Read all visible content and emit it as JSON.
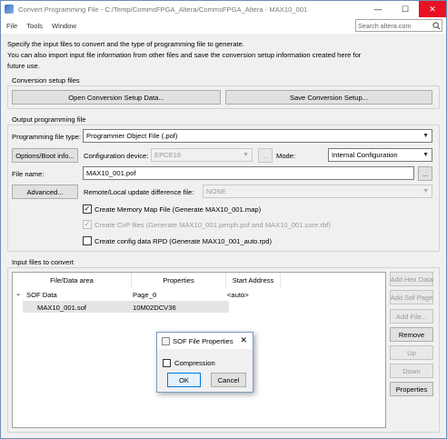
{
  "window": {
    "title": "Convert Programming File - C:/Temp/CommsFPGA_Altera/CommsFPGA_Altera - MAX10_001",
    "minimize": "—",
    "maximize": "☐",
    "close": "✕"
  },
  "menu": {
    "items": [
      "File",
      "Tools",
      "Window"
    ]
  },
  "search": {
    "placeholder": "Search altera.com"
  },
  "description": {
    "line1": "Specify the input files to convert and the type of programming file to generate.",
    "line2": "You can also import input file information from other files and save the conversion setup information created here for",
    "line3": "future use."
  },
  "conversion_setup": {
    "label": "Conversion setup files",
    "open_button": "Open Conversion Setup Data...",
    "save_button": "Save Conversion Setup..."
  },
  "output": {
    "label": "Output programming file",
    "file_type_label": "Programming file type:",
    "file_type_value": "Programmer Object File (.pof)",
    "options_button": "Options/Boot info...",
    "config_device_label": "Configuration device:",
    "config_device_value": "EPCE16",
    "browse_device": "...",
    "mode_label": "Mode:",
    "mode_value": "Internal Configuration",
    "file_name_label": "File name:",
    "file_name_value": "MAX10_001.pof",
    "browse_file": "...",
    "advanced_button": "Advanced...",
    "remote_label": "Remote/Local update difference file:",
    "remote_value": "NONE",
    "create_map_label": "Create Memory Map File (Generate MAX10_001.map)",
    "create_map_checked": true,
    "create_cvp_label": "Create CvP files (Generate MAX10_001.periph.pof and MAX10_001.core.rbf)",
    "create_cvp_checked": true,
    "create_rpd_label": "Create config data RPD (Generate MAX10_001_auto.rpd)",
    "create_rpd_checked": false
  },
  "input_files": {
    "label": "Input files to convert",
    "columns": [
      "File/Data area",
      "Properties",
      "Start Address"
    ],
    "rows": [
      {
        "expand": "⌄",
        "name": "SOF Data",
        "properties": "Page_0",
        "start": "<auto>"
      },
      {
        "name": "MAX10_001.sof",
        "properties": "10M02DCV36",
        "start": ""
      }
    ],
    "side_buttons": {
      "add_hex": "Add Hex Data",
      "add_sof": "Add Sof Page",
      "add_file": "Add File...",
      "remove": "Remove",
      "up": "Up",
      "down": "Down",
      "properties": "Properties"
    }
  },
  "sof_dialog": {
    "title": "SOF File Properties",
    "close": "✕",
    "compression_label": "Compression",
    "compression_checked": false,
    "ok": "OK",
    "cancel": "Cancel"
  },
  "colors": {
    "close_red": "#e81123",
    "dialog_border": "#7a9cc6",
    "focus_blue": "#0078d7"
  }
}
